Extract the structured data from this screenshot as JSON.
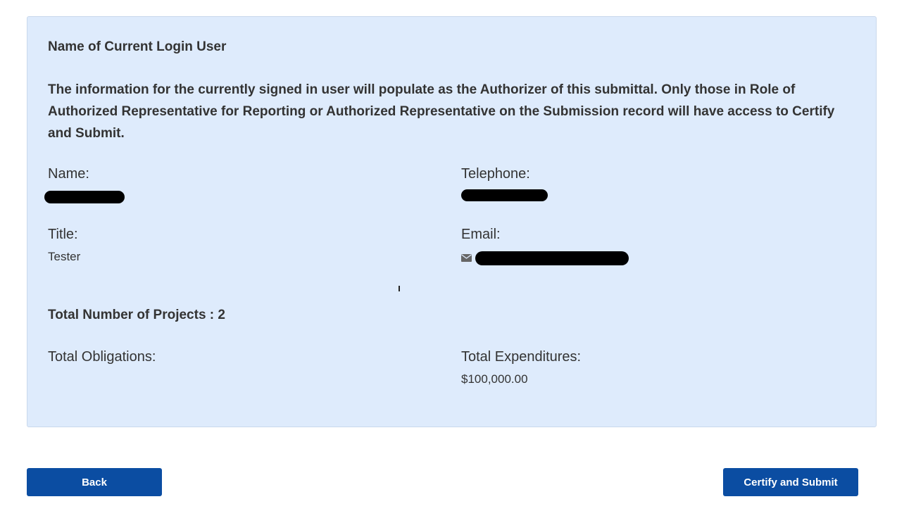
{
  "section": {
    "title": "Name of Current Login User",
    "info": "The information for the currently signed in user will populate as the Authorizer of this submittal. Only those in Role of Authorized Representative for Reporting or Authorized Representative on the Submission record will have access to Certify and Submit."
  },
  "user": {
    "name_label": "Name:",
    "telephone_label": "Telephone:",
    "title_label": "Title:",
    "title_value": "Tester",
    "email_label": "Email:",
    "email_icon": "envelope-icon"
  },
  "totals": {
    "projects_text": "Total Number of Projects : 2",
    "obligations_label": "Total Obligations:",
    "expenditures_label": "Total Expenditures:",
    "expenditures_value": "$100,000.00"
  },
  "buttons": {
    "back": "Back",
    "certify": "Certify and Submit"
  },
  "colors": {
    "panel_bg": "#deebfc",
    "button_bg": "#0b4da2",
    "text": "#333333"
  }
}
